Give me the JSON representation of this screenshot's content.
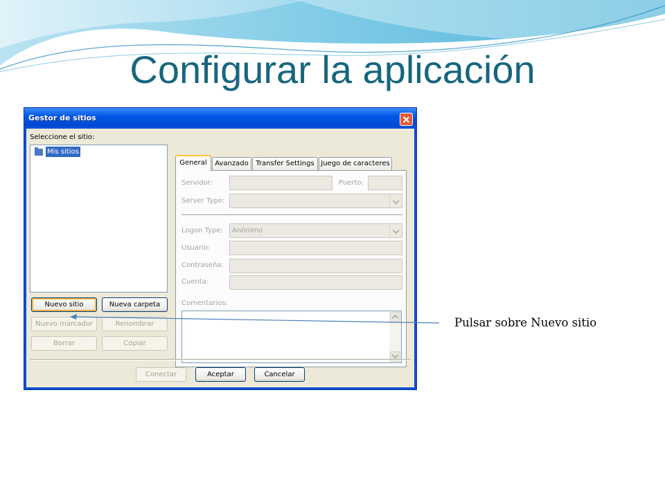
{
  "slide": {
    "title": "Configurar la aplicación",
    "callout": "Pulsar sobre Nuevo sitio",
    "accent_color": "#17667f"
  },
  "dialog": {
    "title": "Gestor de sitios",
    "select_label": "Seleccione el sitio:",
    "tree": {
      "root_label": "Mis sitios",
      "root_icon": "folder-icon"
    },
    "buttons": {
      "new_site": "Nuevo sitio",
      "new_folder": "Nueva carpeta",
      "new_bookmark": "Nuevo marcador",
      "rename": "Renombrar",
      "delete": "Borrar",
      "copy": "Copiar",
      "connect": "Conectar",
      "ok": "Aceptar",
      "cancel": "Cancelar"
    },
    "tabs": [
      "General",
      "Avanzado",
      "Transfer Settings",
      "Juego de caracteres"
    ],
    "general": {
      "server_label": "Servidor:",
      "port_label": "Puerto:",
      "server_type_label": "Server Type:",
      "logon_type_label": "Logon Type:",
      "logon_type_value": "Anónimo",
      "user_label": "Usuario:",
      "password_label": "Contraseña:",
      "account_label": "Cuenta:",
      "comments_label": "Comentarios:"
    }
  }
}
